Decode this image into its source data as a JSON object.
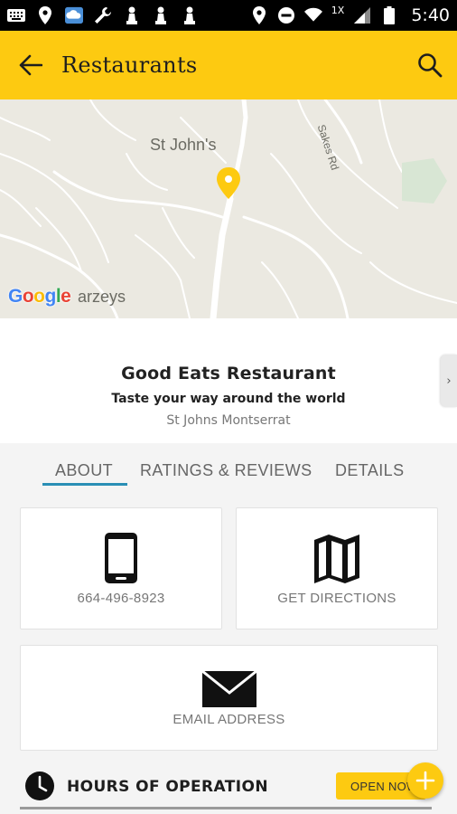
{
  "status_bar": {
    "time": "5:40",
    "network_badge": "1X",
    "icons": [
      "keyboard-icon",
      "location-pin-icon",
      "cloud-app-icon",
      "wrench-icon",
      "chess-pawn-icon",
      "chess-pawn-icon",
      "chess-pawn-icon",
      "location-icon",
      "do-not-disturb-icon",
      "wifi-icon",
      "signal-icon",
      "battery-icon"
    ]
  },
  "app_bar": {
    "title": "Restaurants",
    "back_icon": "arrow-left-icon",
    "search_icon": "search-icon",
    "color": "#fdca11"
  },
  "map": {
    "town_label": "St John's",
    "road_label": "Sakes Rd",
    "area_label": "arzeys",
    "google_logo": [
      "G",
      "o",
      "o",
      "g",
      "l",
      "e"
    ],
    "pin_color": "#fdca11"
  },
  "business": {
    "name": "Good Eats Restaurant",
    "tagline": "Taste your way around the world",
    "location": "St Johns Montserrat",
    "side_tab_glyph": "›"
  },
  "tabs": [
    {
      "label": "ABOUT",
      "active": true
    },
    {
      "label": "RATINGS & REVIEWS",
      "active": false
    },
    {
      "label": "DETAILS",
      "active": false
    }
  ],
  "actions": {
    "phone": {
      "label": "664-496-8923",
      "icon": "phone-icon"
    },
    "directions": {
      "label": "GET DIRECTIONS",
      "icon": "map-icon"
    },
    "email": {
      "label": "EMAIL ADDRESS",
      "icon": "envelope-icon"
    }
  },
  "hours": {
    "label": "HOURS OF OPERATION",
    "status": "OPEN NOW"
  },
  "colors": {
    "accent": "#fdca11",
    "tab_indicator": "#2a8fb5",
    "map_bg": "#ebe9e1"
  }
}
